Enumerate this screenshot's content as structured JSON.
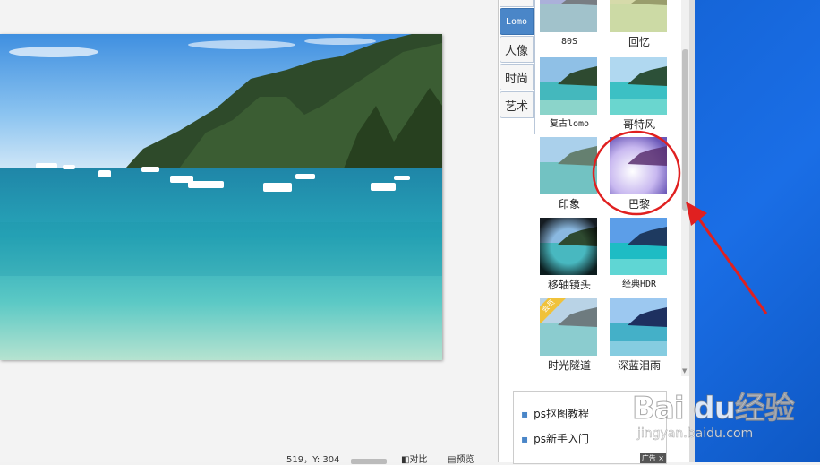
{
  "tabs": [
    {
      "label": "Lomo",
      "active": true
    },
    {
      "label": "人像",
      "active": false
    },
    {
      "label": "时尚",
      "active": false
    },
    {
      "label": "艺术",
      "active": false
    }
  ],
  "filters": [
    {
      "label": "80S"
    },
    {
      "label": "回忆"
    },
    {
      "label": "复古lomo"
    },
    {
      "label": "哥特风"
    },
    {
      "label": "印象"
    },
    {
      "label": "巴黎"
    },
    {
      "label": "移轴镜头"
    },
    {
      "label": "经典HDR"
    },
    {
      "label": "时光隧道",
      "badge": "会员"
    },
    {
      "label": "深蓝泪雨"
    }
  ],
  "ad": {
    "items": [
      "ps抠图教程",
      "ps新手入门"
    ],
    "tag": "广告"
  },
  "statusbar": {
    "coords": "519，Y: 304",
    "compare_label": "对比",
    "preview_label": "预览"
  },
  "watermark": {
    "brand": "Bai du经验",
    "url": "jingyan.baidu.com"
  },
  "colors": {
    "accent": "#4a86c8",
    "highlight": "#e02020"
  }
}
